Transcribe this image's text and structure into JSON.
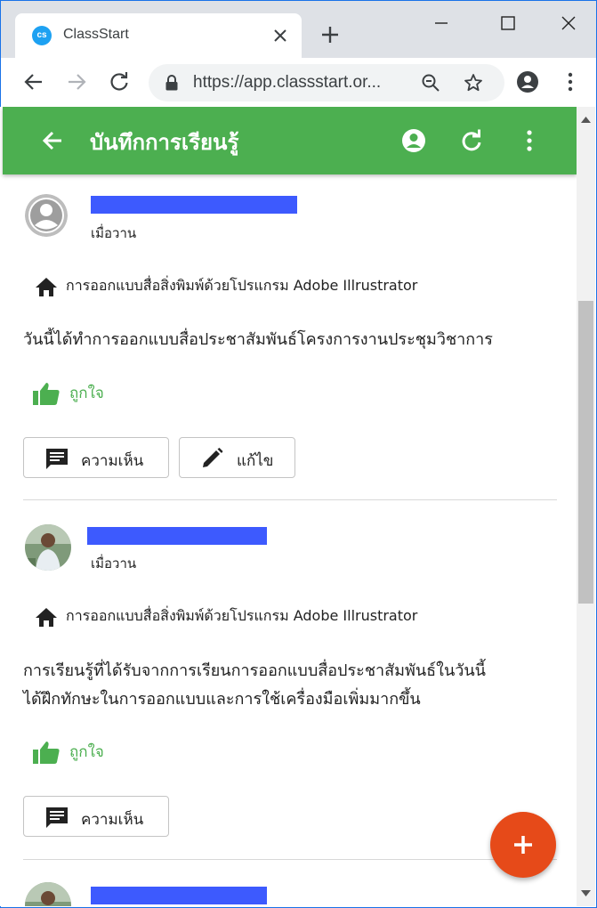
{
  "browser": {
    "tab_title": "ClassStart",
    "favicon_text": "cs",
    "url": "https://app.classstart.or...",
    "colors": {
      "tabstrip": "#dee1e6",
      "favicon": "#1da1f2"
    }
  },
  "app": {
    "title": "บันทึกการเรียนรู้",
    "colors": {
      "appbar": "#4caf50",
      "fab": "#e64a19",
      "like": "#4caf50",
      "redaction": "#3d5afe"
    },
    "icons": [
      "back-arrow-icon",
      "account-circle-icon",
      "refresh-icon",
      "more-vert-icon"
    ]
  },
  "posts": [
    {
      "time": "เมื่อวาน",
      "course": "การออกแบบสื่อสิ่งพิมพ์ด้วยโปรแกรม Adobe Illrustrator",
      "body_lines": [
        "วันนี้ได้ทำการออกแบบสื่อประชาสัมพันธ์โครงการงานประชุมวิชาการ"
      ],
      "like_label": "ถูกใจ",
      "comment_label": "ความเห็น",
      "edit_label": "แก้ไข"
    },
    {
      "time": "เมื่อวาน",
      "course": "การออกแบบสื่อสิ่งพิมพ์ด้วยโปรแกรม Adobe Illrustrator",
      "body_lines": [
        "การเรียนรู้ที่ได้รับจากการเรียนการออกแบบสื่อประชาสัมพันธ์ในวันนี้",
        "ได้ฝึกทักษะในการออกแบบและการใช้เครื่องมือเพิ่มมากขึ้น"
      ],
      "like_label": "ถูกใจ",
      "comment_label": "ความเห็น"
    }
  ]
}
